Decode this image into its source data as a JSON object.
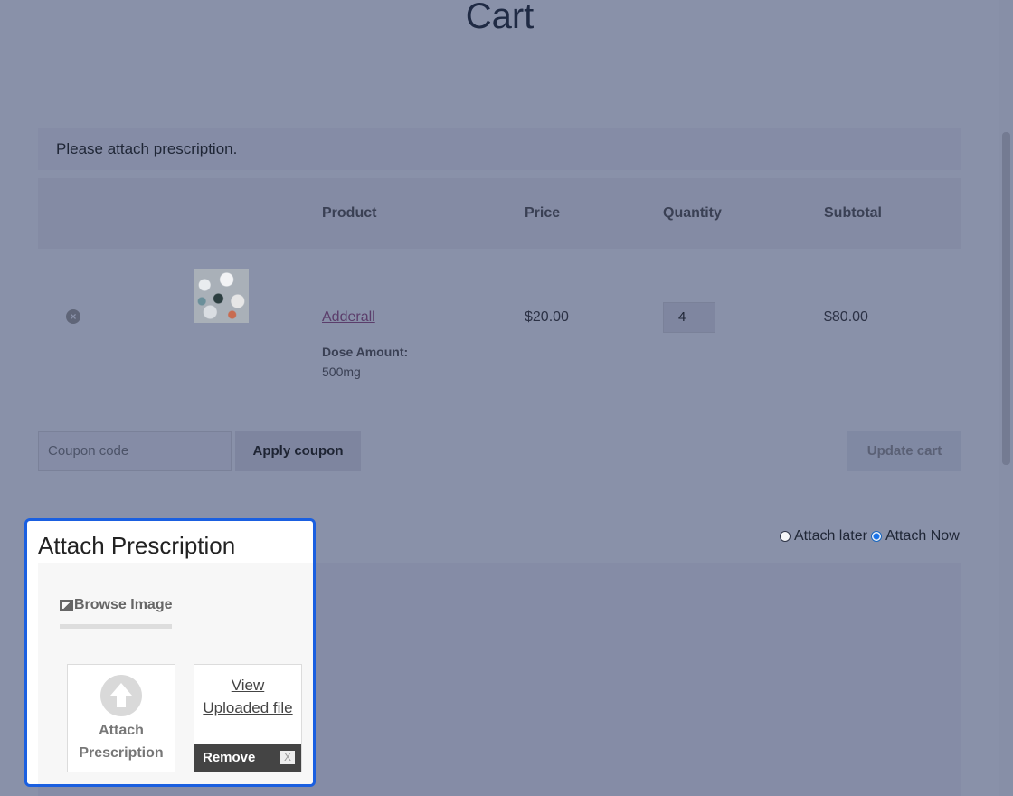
{
  "page": {
    "title": "Cart"
  },
  "notice": {
    "text": "Please attach prescription."
  },
  "table": {
    "headers": {
      "product": "Product",
      "price": "Price",
      "quantity": "Quantity",
      "subtotal": "Subtotal"
    },
    "rows": [
      {
        "remove_icon": "close-circle-icon",
        "product_name": "Adderall",
        "dose_label": "Dose Amount:",
        "dose_value": "500mg",
        "price": "$20.00",
        "quantity": "4",
        "subtotal": "$80.00"
      }
    ]
  },
  "coupon": {
    "placeholder": "Coupon code",
    "apply_label": "Apply coupon"
  },
  "update_cart_label": "Update cart",
  "attach_options": {
    "later_label": "Attach later",
    "now_label": "Attach Now",
    "selected": "now"
  },
  "modal": {
    "title": "Attach Prescription",
    "browse_label": "Browse Image",
    "browse_icon": "image-icon",
    "attach_label_line1": "Attach",
    "attach_label_line2": "Prescription",
    "upload_icon": "upload-arrow-icon",
    "view_line1": "View",
    "view_line2": "Uploaded file",
    "remove_label": "Remove",
    "remove_close": "X"
  },
  "colors": {
    "overlay": "#8991a9",
    "modal_border": "#1a5fe0",
    "remove_bar": "#444444"
  }
}
